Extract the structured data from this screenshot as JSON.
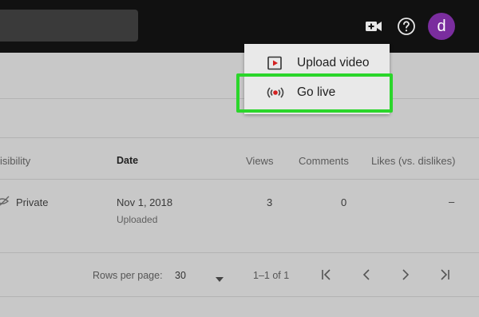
{
  "header": {
    "avatar_letter": "d",
    "icons": [
      "create-video-icon",
      "help-icon"
    ]
  },
  "menu": {
    "items": [
      {
        "label": "Upload video",
        "icon": "upload-video-icon"
      },
      {
        "label": "Go live",
        "icon": "go-live-icon"
      }
    ],
    "highlight_color": "#2bd62b"
  },
  "table": {
    "columns": {
      "visibility": "isibility",
      "date": "Date",
      "views": "Views",
      "comments": "Comments",
      "likes": "Likes (vs. dislikes)"
    },
    "rows": [
      {
        "visibility": "Private",
        "date": "Nov 1, 2018",
        "date_status": "Uploaded",
        "views": "3",
        "comments": "0",
        "likes": "–"
      }
    ]
  },
  "pagination": {
    "rows_per_page_label": "Rows per page:",
    "rows_per_page_value": "30",
    "range": "1–1 of 1"
  },
  "colors": {
    "topbar": "#111111",
    "avatar": "#7a2d9e",
    "live_red": "#d32020"
  }
}
